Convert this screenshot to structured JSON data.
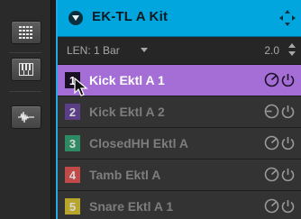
{
  "rail": {
    "buttons": [
      "pad-grid-icon",
      "keyboard-icon",
      "waveform-icon"
    ]
  },
  "kit": {
    "title": "EK-TL A Kit",
    "accent": "#00a6dd"
  },
  "length": {
    "label": "LEN: 1 Bar",
    "value": "2.0"
  },
  "sounds": [
    {
      "num": "1",
      "name": "Kick Ektl A 1",
      "color": "#a56ed6",
      "selected": true
    },
    {
      "num": "2",
      "name": "Kick Ektl A 2",
      "color": "#5b3f86",
      "selected": false
    },
    {
      "num": "3",
      "name": "ClosedHH Ektl A",
      "color": "#2e8a62",
      "selected": false
    },
    {
      "num": "4",
      "name": "Tamb Ektl A",
      "color": "#c04a48",
      "selected": false
    },
    {
      "num": "5",
      "name": "Snare Ektl A 1",
      "color": "#b8a62c",
      "selected": false
    }
  ]
}
